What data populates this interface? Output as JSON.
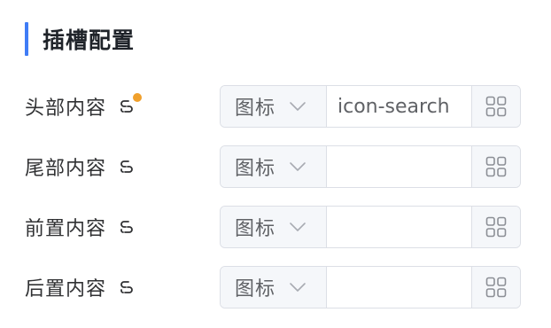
{
  "section": {
    "title": "插槽配置"
  },
  "rows": [
    {
      "label": "头部内容",
      "slot_icon": "slot-link-icon",
      "modified": true,
      "type_value": "图标",
      "input_value": "icon-search",
      "picker_icon": "grid-icon"
    },
    {
      "label": "尾部内容",
      "slot_icon": "slot-link-icon",
      "modified": false,
      "type_value": "图标",
      "input_value": "",
      "picker_icon": "grid-icon"
    },
    {
      "label": "前置内容",
      "slot_icon": "slot-link-icon",
      "modified": false,
      "type_value": "图标",
      "input_value": "",
      "picker_icon": "grid-icon"
    },
    {
      "label": "后置内容",
      "slot_icon": "slot-link-icon",
      "modified": false,
      "type_value": "图标",
      "input_value": "",
      "picker_icon": "grid-icon"
    }
  ],
  "colors": {
    "accent": "#3f7cf6",
    "modified_dot": "#f0a02c",
    "border": "#dcdfe6",
    "addon_bg": "#f5f7fa"
  }
}
